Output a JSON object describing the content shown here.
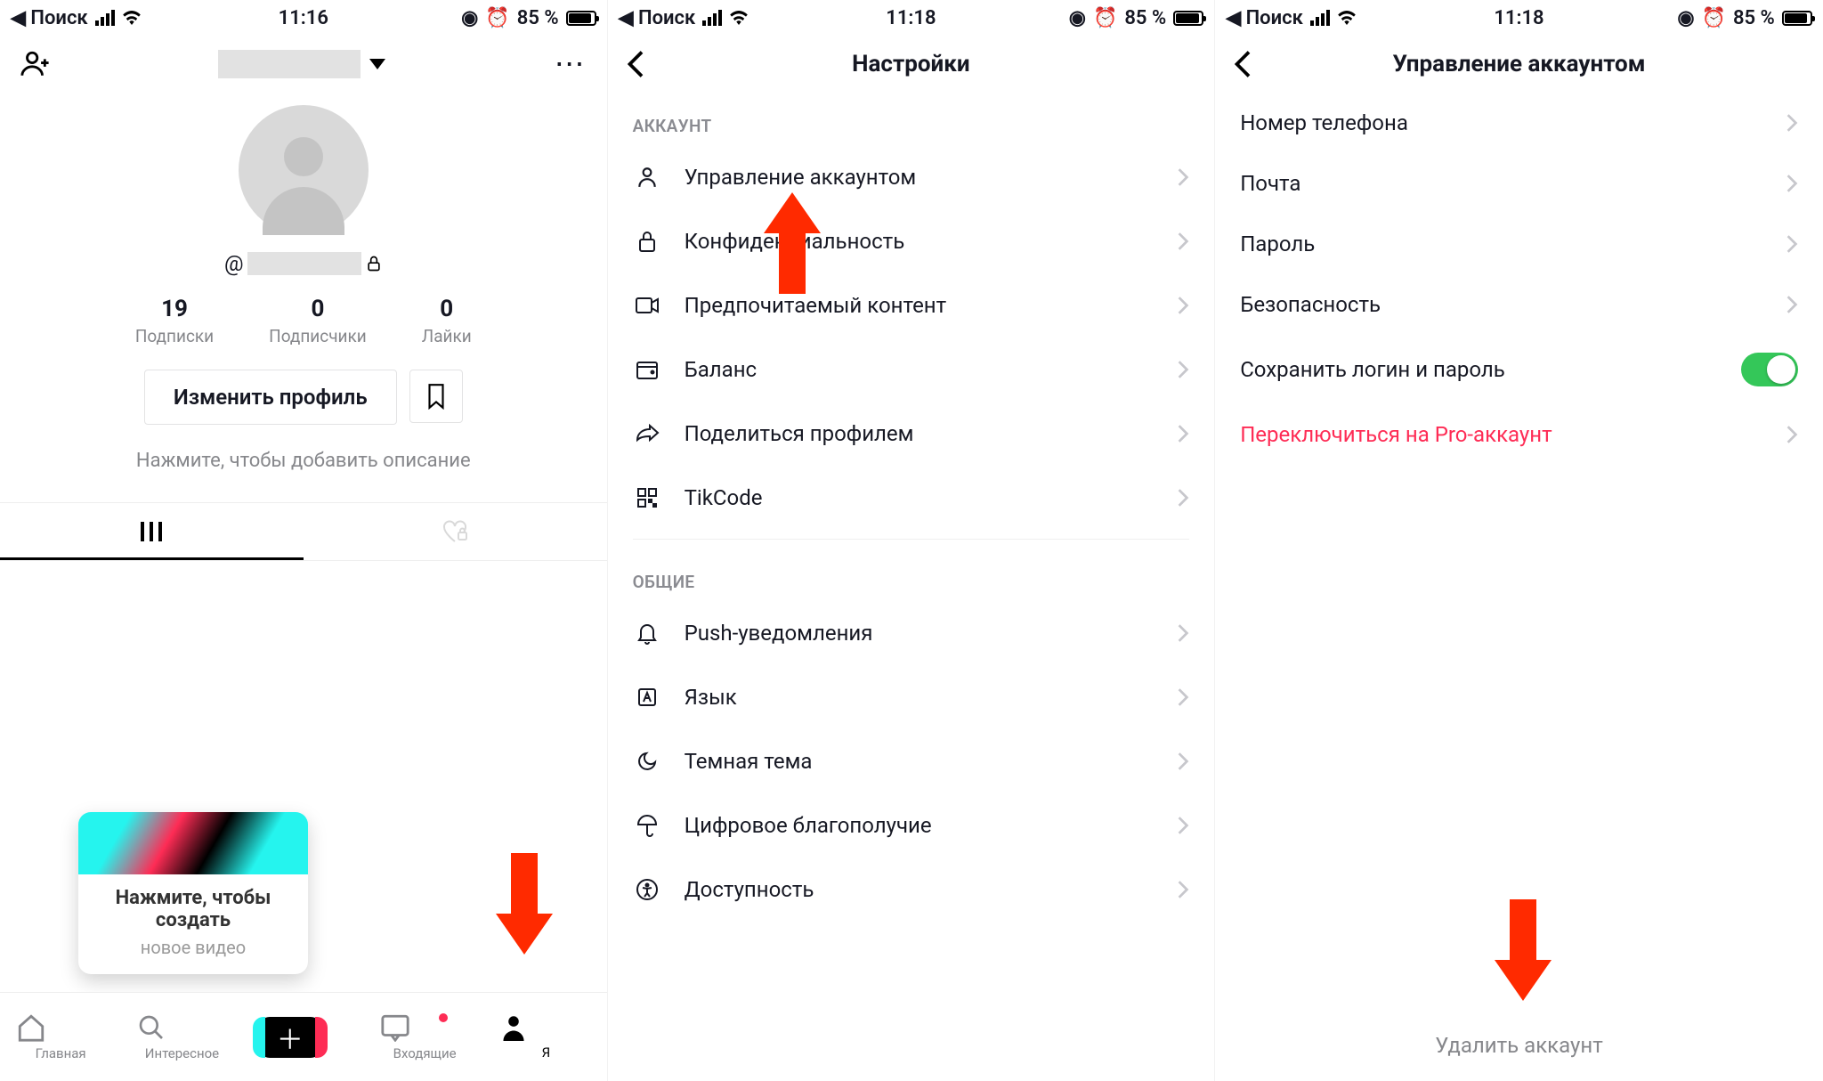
{
  "status": {
    "back_app": "Поиск",
    "battery_pct": "85 %",
    "time_s1": "11:16",
    "time_s2": "11:18",
    "time_s3": "11:18"
  },
  "profile": {
    "username_prefix": "@",
    "stats": [
      {
        "n": "19",
        "l": "Подписки"
      },
      {
        "n": "0",
        "l": "Подписчики"
      },
      {
        "n": "0",
        "l": "Лайки"
      }
    ],
    "edit_btn": "Изменить профиль",
    "bio_placeholder": "Нажмите, чтобы добавить описание",
    "tip_line1": "Нажмите, чтобы",
    "tip_line2": "создать",
    "tip_line3": "новое видео",
    "nav": {
      "home": "Главная",
      "discover": "Интересное",
      "inbox": "Входящие",
      "me": "Я"
    }
  },
  "settings": {
    "title": "Настройки",
    "section_account": "АККАУНТ",
    "section_general": "ОБЩИЕ",
    "account": [
      "Управление аккаунтом",
      "Конфиденциальность",
      "Предпочитаемый контент",
      "Баланс",
      "Поделиться профилем",
      "TikCode"
    ],
    "general": [
      "Push-уведомления",
      "Язык",
      "Темная тема",
      "Цифровое благополучие",
      "Доступность"
    ]
  },
  "manage": {
    "title": "Управление аккаунтом",
    "rows": [
      "Номер телефона",
      "Почта",
      "Пароль",
      "Безопасность",
      "Сохранить логин и пароль",
      "Переключиться на Pro-аккаунт"
    ],
    "delete": "Удалить аккаунт"
  }
}
